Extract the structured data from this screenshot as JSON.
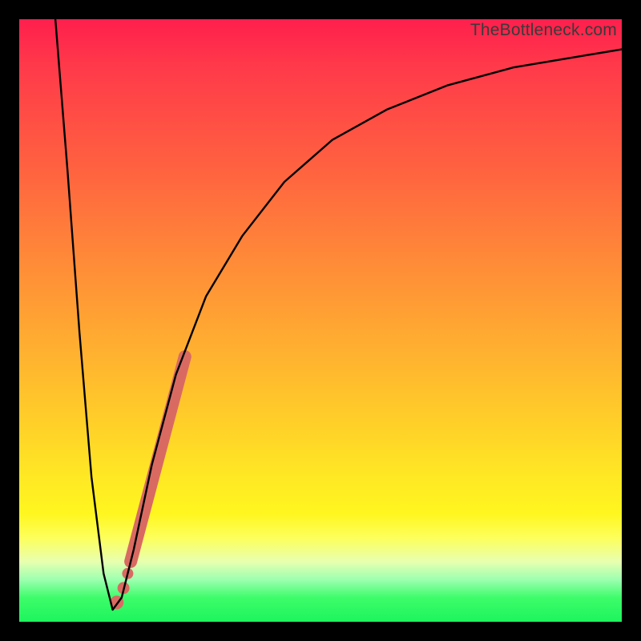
{
  "watermark": "TheBottleneck.com",
  "colors": {
    "frame": "#000000",
    "curve": "#000000",
    "highlight": "#d96a62"
  },
  "chart_data": {
    "type": "line",
    "title": "",
    "xlabel": "",
    "ylabel": "",
    "xlim": [
      0,
      100
    ],
    "ylim": [
      0,
      100
    ],
    "grid": false,
    "legend": false,
    "series": [
      {
        "name": "bottleneck-curve",
        "x": [
          6,
          8,
          10,
          12,
          14,
          15.5,
          17,
          19,
          22,
          26,
          31,
          37,
          44,
          52,
          61,
          71,
          82,
          94,
          100
        ],
        "y": [
          100,
          75,
          48,
          24,
          8,
          2,
          4,
          12,
          26,
          41,
          54,
          64,
          73,
          80,
          85,
          89,
          92,
          94,
          95
        ]
      }
    ],
    "highlighted_region": {
      "description": "thick pink segment and dots near the valley",
      "segment": {
        "x": [
          18.5,
          27.5
        ],
        "y": [
          10,
          44
        ]
      },
      "dots": [
        {
          "x": 16.2,
          "y": 3.2
        },
        {
          "x": 17.3,
          "y": 5.6
        },
        {
          "x": 18.0,
          "y": 8.0
        }
      ]
    },
    "gradient_stops": [
      {
        "pos": 0,
        "color": "#ff1f4d"
      },
      {
        "pos": 24,
        "color": "#ff6040"
      },
      {
        "pos": 55,
        "color": "#ffb030"
      },
      {
        "pos": 82,
        "color": "#fff61f"
      },
      {
        "pos": 96,
        "color": "#3efc6a"
      }
    ]
  }
}
